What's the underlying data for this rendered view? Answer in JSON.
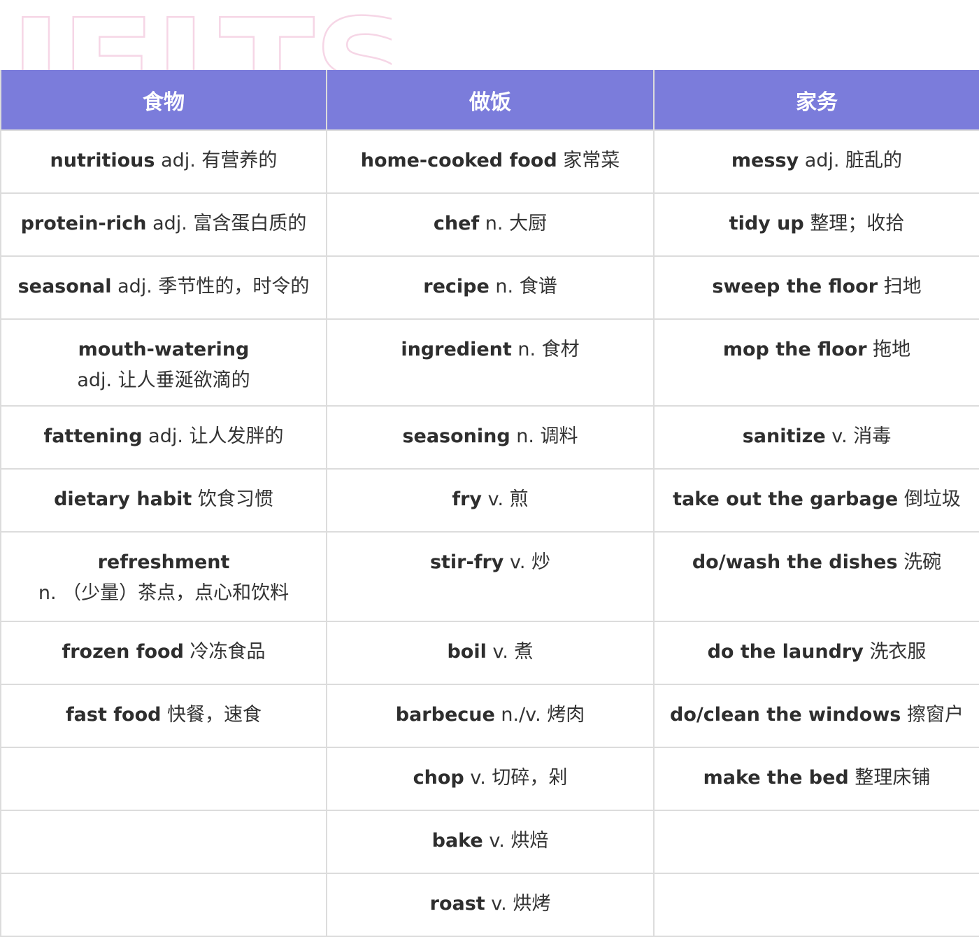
{
  "watermark": {
    "text": "IELTS"
  },
  "columns": [
    "食物",
    "做饭",
    "家务"
  ],
  "rows": [
    [
      {
        "term": "nutritious",
        "definition": "adj. 有营养的"
      },
      {
        "term": "home-cooked food",
        "definition": "家常菜"
      },
      {
        "term": "messy",
        "definition": "adj. 脏乱的"
      }
    ],
    [
      {
        "term": "protein-rich",
        "definition": "adj. 富含蛋白质的"
      },
      {
        "term": "chef",
        "definition": "n. 大厨"
      },
      {
        "term": "tidy up",
        "definition": "整理；收拾"
      }
    ],
    [
      {
        "term": "seasonal",
        "definition": "adj. 季节性的，时令的"
      },
      {
        "term": "recipe",
        "definition": "n. 食谱"
      },
      {
        "term": "sweep the floor",
        "definition": "扫地"
      }
    ],
    [
      {
        "term": "mouth-watering",
        "definition": "adj. 让人垂涎欲滴的"
      },
      {
        "term": "ingredient",
        "definition": "n. 食材"
      },
      {
        "term": "mop the floor",
        "definition": "拖地"
      }
    ],
    [
      {
        "term": "fattening",
        "definition": "adj. 让人发胖的"
      },
      {
        "term": "seasoning",
        "definition": "n. 调料"
      },
      {
        "term": "sanitize",
        "definition": "v. 消毒"
      }
    ],
    [
      {
        "term": "dietary habit",
        "definition": "饮食习惯"
      },
      {
        "term": "fry",
        "definition": "v. 煎"
      },
      {
        "term": "take out the garbage",
        "definition": "倒垃圾"
      }
    ],
    [
      {
        "term": "refreshment",
        "definition": "n. （少量）茶点，点心和饮料"
      },
      {
        "term": "stir-fry",
        "definition": "v. 炒"
      },
      {
        "term": "do/wash the dishes",
        "definition": "洗碗"
      }
    ],
    [
      {
        "term": "frozen food",
        "definition": "冷冻食品"
      },
      {
        "term": "boil",
        "definition": "v. 煮"
      },
      {
        "term": "do the laundry",
        "definition": "洗衣服"
      }
    ],
    [
      {
        "term": "fast food",
        "definition": "快餐，速食"
      },
      {
        "term": "barbecue",
        "definition": "n./v. 烤肉"
      },
      {
        "term": "do/clean the windows",
        "definition": "擦窗户"
      }
    ],
    [
      {
        "term": "",
        "definition": ""
      },
      {
        "term": "chop",
        "definition": "v. 切碎，剁"
      },
      {
        "term": "make the bed",
        "definition": "整理床铺"
      }
    ],
    [
      {
        "term": "",
        "definition": ""
      },
      {
        "term": "bake",
        "definition": "v. 烘焙"
      },
      {
        "term": "",
        "definition": ""
      }
    ],
    [
      {
        "term": "",
        "definition": ""
      },
      {
        "term": "roast",
        "definition": "v. 烘烤"
      },
      {
        "term": "",
        "definition": ""
      }
    ]
  ],
  "colors": {
    "header_background": "#7b7cdb",
    "header_text": "#ffffff",
    "grid_border": "#dcdcdc",
    "watermark_pink": "#f6d6e6",
    "watermark_blue": "#d8def4"
  }
}
